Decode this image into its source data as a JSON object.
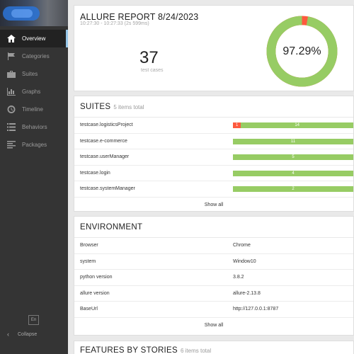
{
  "sidebar": {
    "items": [
      {
        "label": "Overview",
        "icon": "home-icon",
        "active": true
      },
      {
        "label": "Categories",
        "icon": "flag-icon"
      },
      {
        "label": "Suites",
        "icon": "briefcase-icon"
      },
      {
        "label": "Graphs",
        "icon": "bar-chart-icon"
      },
      {
        "label": "Timeline",
        "icon": "clock-icon"
      },
      {
        "label": "Behaviors",
        "icon": "list-icon"
      },
      {
        "label": "Packages",
        "icon": "align-left-icon"
      }
    ],
    "language": "En",
    "collapse_label": "Collapse"
  },
  "summary": {
    "title": "ALLURE REPORT 8/24/2023",
    "time_range": "10:27:30 - 10:27:33 (2s 599ms)",
    "test_count": "37",
    "test_count_label": "test cases",
    "success_rate": 97.29,
    "success_rate_label": "97.29%",
    "colors": {
      "passed": "#97cc64",
      "failed": "#fd5a3e"
    }
  },
  "suites": {
    "title": "SUITES",
    "total": "5 items total",
    "items": [
      {
        "name": "testcase.logisticsProject",
        "failed": "1",
        "passed": "14"
      },
      {
        "name": "testcase.e-commerce",
        "failed": "",
        "passed": "11"
      },
      {
        "name": "testcase.userManager",
        "failed": "",
        "passed": "5"
      },
      {
        "name": "testcase.login",
        "failed": "",
        "passed": "4"
      },
      {
        "name": "testcase.systemManager",
        "failed": "",
        "passed": "2"
      }
    ],
    "show_all": "Show all"
  },
  "environment": {
    "title": "ENVIRONMENT",
    "rows": [
      {
        "key": "Browser",
        "value": "Chrome"
      },
      {
        "key": "system",
        "value": "Window10"
      },
      {
        "key": "python version",
        "value": "3.8.2"
      },
      {
        "key": "allure version",
        "value": "allure-2.13.8"
      },
      {
        "key": "BaseUrl",
        "value": "http://127.0.0.1:8787"
      }
    ],
    "show_all": "Show all"
  },
  "features": {
    "title": "FEATURES BY STORIES",
    "total": "6 items total"
  }
}
